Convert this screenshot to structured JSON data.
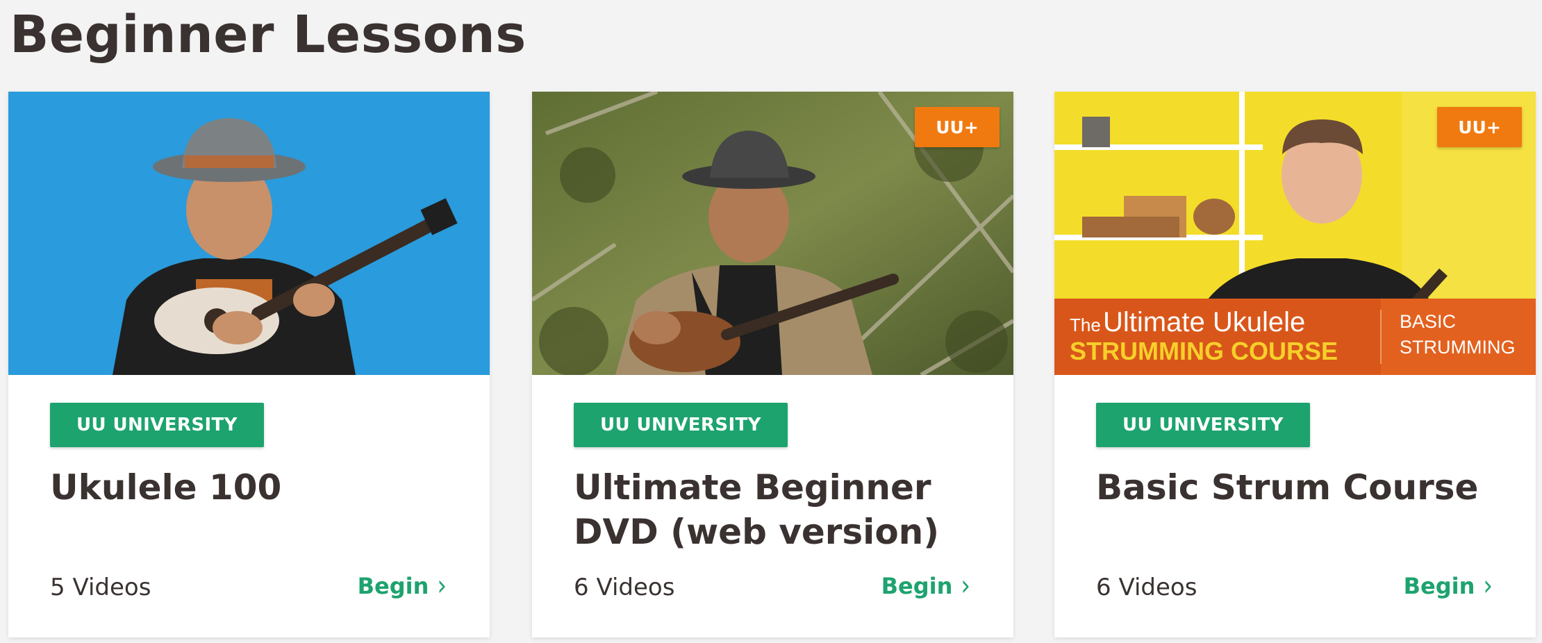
{
  "section": {
    "title": "Beginner Lessons"
  },
  "cards": [
    {
      "tag": "UU UNIVERSITY",
      "title": "Ukulele 100",
      "videos": "5 Videos",
      "cta": "Begin",
      "badge": null,
      "thumb_bg": "#2a9bdc"
    },
    {
      "tag": "UU UNIVERSITY",
      "title": "Ultimate Beginner DVD (web version)",
      "videos": "6 Videos",
      "cta": "Begin",
      "badge": "UU+",
      "thumb_bg": "#6b7a3e"
    },
    {
      "tag": "UU UNIVERSITY",
      "title": "Basic Strum Course",
      "videos": "6 Videos",
      "cta": "Begin",
      "badge": "UU+",
      "thumb_bg": "#f3dd2a",
      "thumb_text": {
        "line1_prefix": "The",
        "line1": "Ultimate Ukulele",
        "line2": "STRUMMING COURSE",
        "side1": "BASIC",
        "side2": "STRUMMING"
      }
    }
  ],
  "colors": {
    "accent_green": "#1da36e",
    "badge_orange": "#f07a10",
    "heading": "#3a3230",
    "page_bg": "#f4f3f3"
  }
}
